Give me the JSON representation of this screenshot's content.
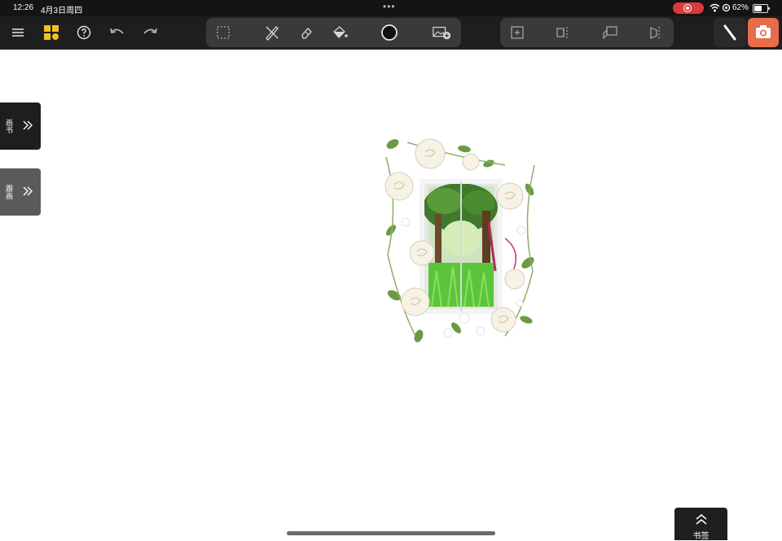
{
  "status_bar": {
    "time": "12:26",
    "date": "4月3日周四",
    "battery_percent_label": "62%",
    "battery_level": 0.62,
    "recording_color": "#d93a3a"
  },
  "toolbar": {
    "left_icons": [
      "menu-icon",
      "app-grid-icon",
      "help-icon",
      "undo-icon",
      "redo-icon"
    ],
    "tool_icons": [
      "lasso-select-icon",
      "pencil-crossed-icon",
      "eraser-icon",
      "fill-bucket-icon",
      "color-swatch-icon",
      "insert-image-icon"
    ],
    "page_icons": [
      "add-page-icon",
      "split-view-icon",
      "layers-icon",
      "mirror-icon"
    ],
    "right_icons": [
      "pen-mode-icon",
      "camera-icon"
    ],
    "accent_color": "#e86b4a",
    "brand_color": "#f2c21a"
  },
  "side_tabs": [
    {
      "label": "画书"
    },
    {
      "label": "跟画"
    }
  ],
  "bookmark": {
    "label": "书签"
  }
}
